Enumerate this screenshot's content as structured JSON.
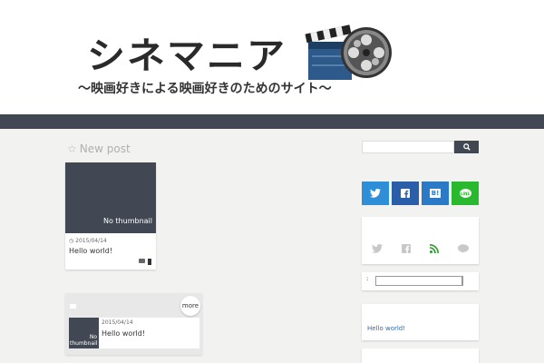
{
  "header": {
    "site_title": "シネマニア",
    "tagline": "〜映画好きによる映画好きのためのサイト〜"
  },
  "main": {
    "section_title": "New post",
    "post_card": {
      "thumbnail_text": "No thumbnail",
      "date": "2015/04/14",
      "title": "Hello world!"
    },
    "category_panel": {
      "more_label": "more",
      "post": {
        "thumbnail_text": "No thumbnail",
        "date": "2015/04/14",
        "title": "Hello world!"
      }
    }
  },
  "sidebar": {
    "search": {
      "placeholder": ""
    },
    "archive_label": ":",
    "recent_post": "Hello world!"
  },
  "colors": {
    "nav_bg": "#424853",
    "twitter": "#2f8ed8",
    "facebook": "#2a5ea8",
    "hatena": "#2a7ac8",
    "line": "#2ab82e",
    "link": "#2a6fb0"
  },
  "icons": [
    "star-icon",
    "clock-icon",
    "folder-icon",
    "file-icon",
    "search-icon",
    "twitter-icon",
    "facebook-icon",
    "hatena-icon",
    "line-icon",
    "rss-icon",
    "film-clapper-icon",
    "film-reel-icon"
  ]
}
